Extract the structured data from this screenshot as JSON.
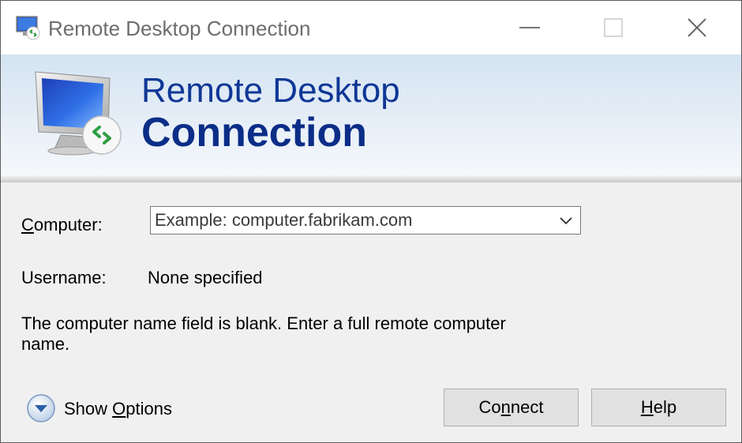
{
  "window": {
    "title": "Remote Desktop Connection"
  },
  "banner": {
    "line1": "Remote Desktop",
    "line2": "Connection"
  },
  "form": {
    "computer_label_mnemonic": "C",
    "computer_label_rest": "omputer:",
    "computer_placeholder": "Example: computer.fabrikam.com",
    "computer_value": "",
    "username_label": "Username:",
    "username_value": "None specified",
    "message": "The computer name field is blank. Enter a full remote computer name."
  },
  "footer": {
    "show_options_pre": "Show ",
    "show_options_mnemonic": "O",
    "show_options_post": "ptions",
    "connect_pre": "Co",
    "connect_mnemonic": "n",
    "connect_post": "nect",
    "help_mnemonic": "H",
    "help_post": "elp"
  },
  "colors": {
    "banner_text": "#0f3795",
    "accent_green": "#3aa84a",
    "button_face": "#e1e1e1"
  },
  "icons": {
    "app": "remote-desktop-icon",
    "banner": "remote-desktop-monitor-icon",
    "options": "chevron-down-circle-icon",
    "dropdown": "chevron-down-icon"
  }
}
